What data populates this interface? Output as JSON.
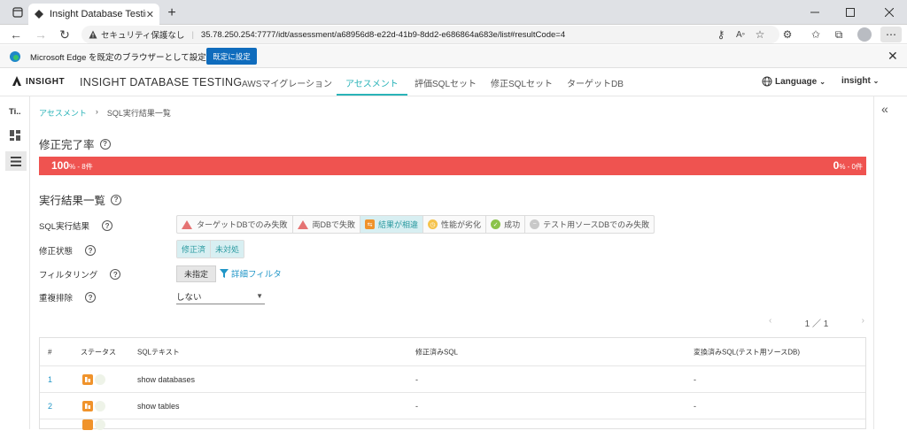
{
  "browser": {
    "tab_title": "Insight Database Testing",
    "security_warning": "セキュリティ保護なし",
    "url": "35.78.250.254:7777/idt/assessment/a68956d8-e22d-41b9-8dd2-e686864a683e/list#resultCode=4",
    "infobar_brand": "Microsoft Edge",
    "infobar_message": "を既定のブラウザーとして設定しますか?",
    "infobar_button": "既定に設定"
  },
  "header": {
    "logo_text": "INSIGHT",
    "app_title": "INSIGHT DATABASE TESTING",
    "nav": [
      {
        "label": "AWSマイグレーション",
        "active": false
      },
      {
        "label": "アセスメント",
        "active": true
      },
      {
        "label": "評価SQLセット",
        "active": false
      },
      {
        "label": "修正SQLセット",
        "active": false
      },
      {
        "label": "ターゲットDB",
        "active": false
      }
    ],
    "language": "Language",
    "user": "insight"
  },
  "leftbar": {
    "label": "Ti.."
  },
  "breadcrumb": {
    "parent": "アセスメント",
    "separator": "›",
    "current": "SQL実行結果一覧"
  },
  "completion": {
    "title": "修正完了率",
    "left_pct": "100",
    "left_suffix": "% - 8件",
    "right_pct": "0",
    "right_suffix": "% - 0件",
    "bar_color": "#ef5350"
  },
  "results": {
    "title": "実行結果一覧",
    "filters": {
      "sql_result_label": "SQL実行結果",
      "sql_result_chips": [
        {
          "label": "ターゲットDBでのみ失敗",
          "icon": "warning-icon"
        },
        {
          "label": "両DBで失敗",
          "icon": "warning-icon"
        },
        {
          "label": "結果が相違",
          "icon": "diff-icon",
          "selected": true
        },
        {
          "label": "性能が劣化",
          "icon": "slow-icon"
        },
        {
          "label": "成功",
          "icon": "check-icon"
        },
        {
          "label": "テスト用ソースDBでのみ失敗",
          "icon": "minus-icon"
        }
      ],
      "fix_status_label": "修正状態",
      "fix_status_chips": [
        "修正済",
        "未対処"
      ],
      "filtering_label": "フィルタリング",
      "unspecified": "未指定",
      "detail_filter": "詳細フィルタ",
      "dedup_label": "重複排除",
      "dedup_value": "しない"
    },
    "pager": {
      "text": "1 ／ 1",
      "prev": "‹",
      "next": "›"
    },
    "table": {
      "headers": [
        "#",
        "ステータス",
        "SQLテキスト",
        "修正済みSQL",
        "変換済みSQL(テスト用ソースDB)"
      ],
      "rows": [
        {
          "num": "1",
          "sql": "show databases",
          "fixed": "-",
          "converted": "-"
        },
        {
          "num": "2",
          "sql": "show tables",
          "fixed": "-",
          "converted": "-"
        }
      ]
    }
  }
}
